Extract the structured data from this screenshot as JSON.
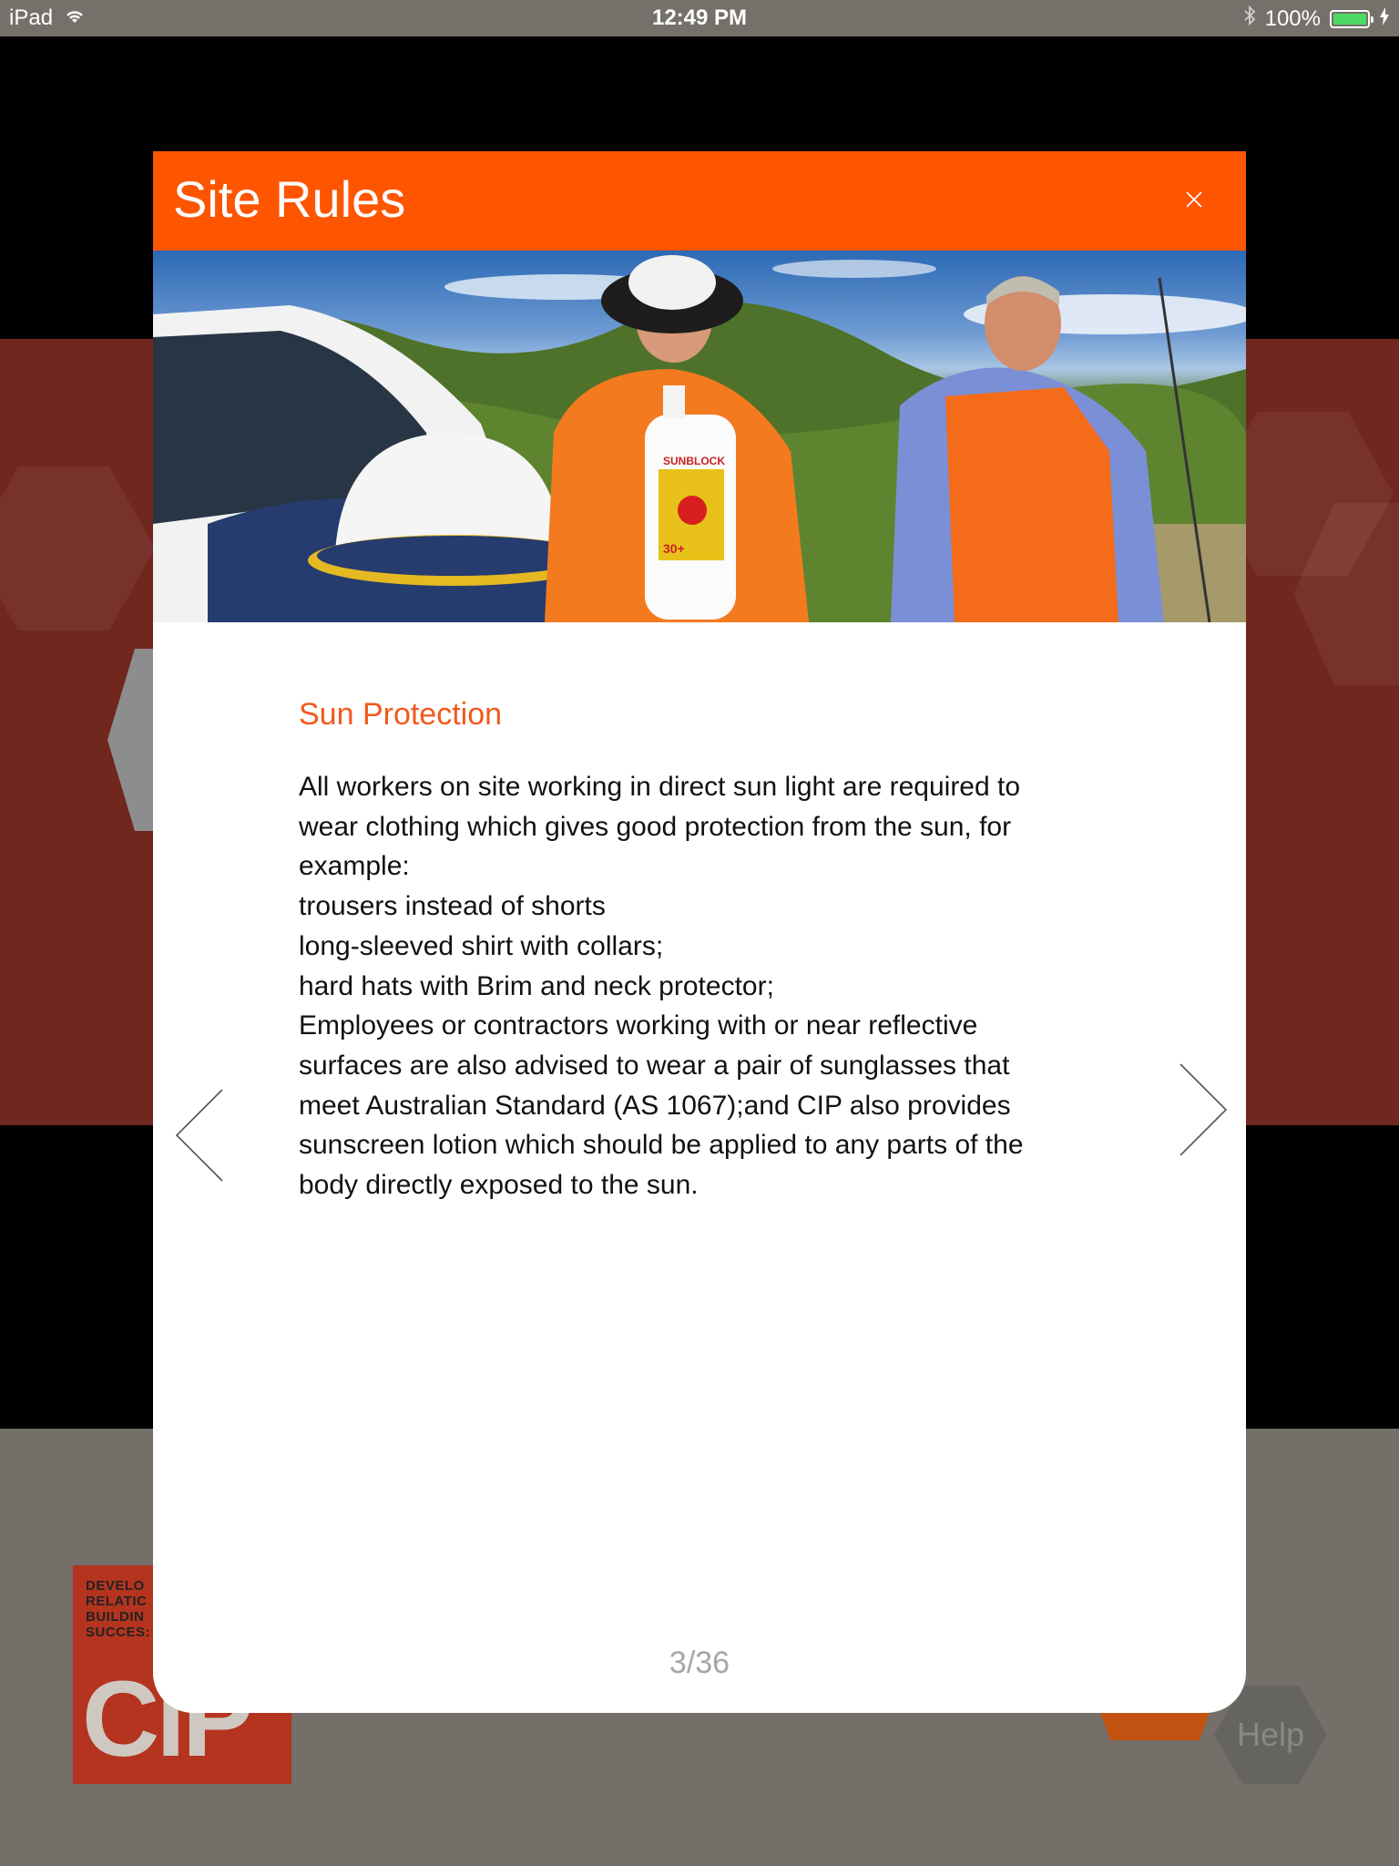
{
  "status_bar": {
    "device": "iPad",
    "time": "12:49 PM",
    "battery": "100%",
    "icons": [
      "wifi-icon",
      "bluetooth-icon",
      "battery-icon",
      "charging-icon"
    ]
  },
  "background": {
    "logo_tagline": [
      "DEVELO",
      "RELATIC",
      "BUILDIN",
      "SUCCES:"
    ],
    "logo_word": "CiP",
    "help_label": "Help"
  },
  "modal": {
    "title": "Site Rules",
    "header_color": "#fe5500",
    "section_title": "Sun Protection",
    "body_lines": [
      "All workers on site working in direct sun light are required to",
      "wear clothing which gives good protection from the sun, for",
      "example:",
      "trousers instead of shorts",
      "long-sleeved shirt with collars;",
      "hard hats with Brim and neck protector;",
      "Employees or contractors working with or near reflective",
      "surfaces are also advised to wear a pair of sunglasses that",
      "meet Australian Standard (AS 1067);and CIP also provides",
      "sunscreen lotion which should be applied to any parts of the",
      "body directly exposed to the sun."
    ],
    "page_indicator": "3/36",
    "hero_image": {
      "description_icon": "site-workers-sun-protection-photo",
      "bottle_label": "SUNBLOCK",
      "bottle_spf": "30+"
    },
    "icons": {
      "close": "close-icon",
      "prev": "chevron-left-icon",
      "next": "chevron-right-icon"
    }
  }
}
